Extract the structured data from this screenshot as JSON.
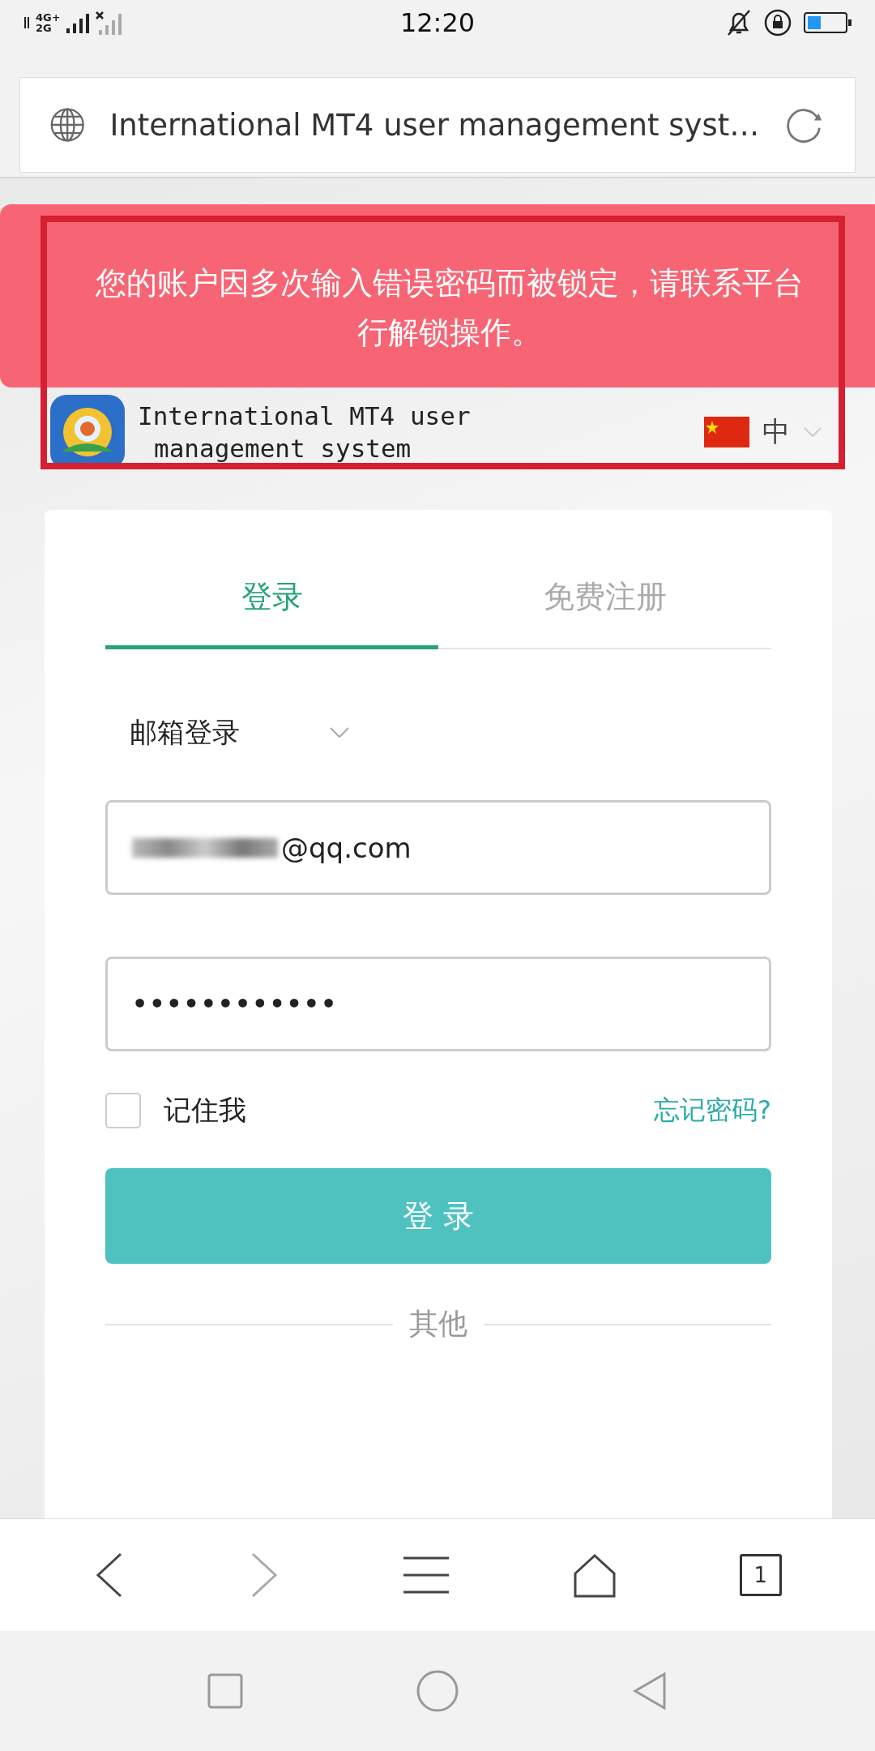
{
  "status_bar": {
    "network_top": "4G+",
    "network_bottom": "2G",
    "time": "12:20"
  },
  "address_bar": {
    "title": "International MT4 user management syst…"
  },
  "toast": {
    "lines": [
      "您的账户因多次输入错误密码而被锁定，请联系平台",
      "行解锁操作。"
    ]
  },
  "site_header": {
    "title_lines": [
      "International MT4 user",
      "management system"
    ],
    "language": "中"
  },
  "tabs": [
    {
      "label": "登录",
      "selected": true
    },
    {
      "label": "免费注册",
      "selected": false
    }
  ],
  "login_method": "邮箱登录",
  "email_field": {
    "value": "@qq.com"
  },
  "password_field": {
    "value": "••••••••••••"
  },
  "remember_me": {
    "label": "记住我",
    "checked": false
  },
  "forgot_link": "忘记密码?",
  "login_button": "登 录",
  "divider_label": "其他",
  "browser_toolbar": {
    "tab_count": "1"
  }
}
